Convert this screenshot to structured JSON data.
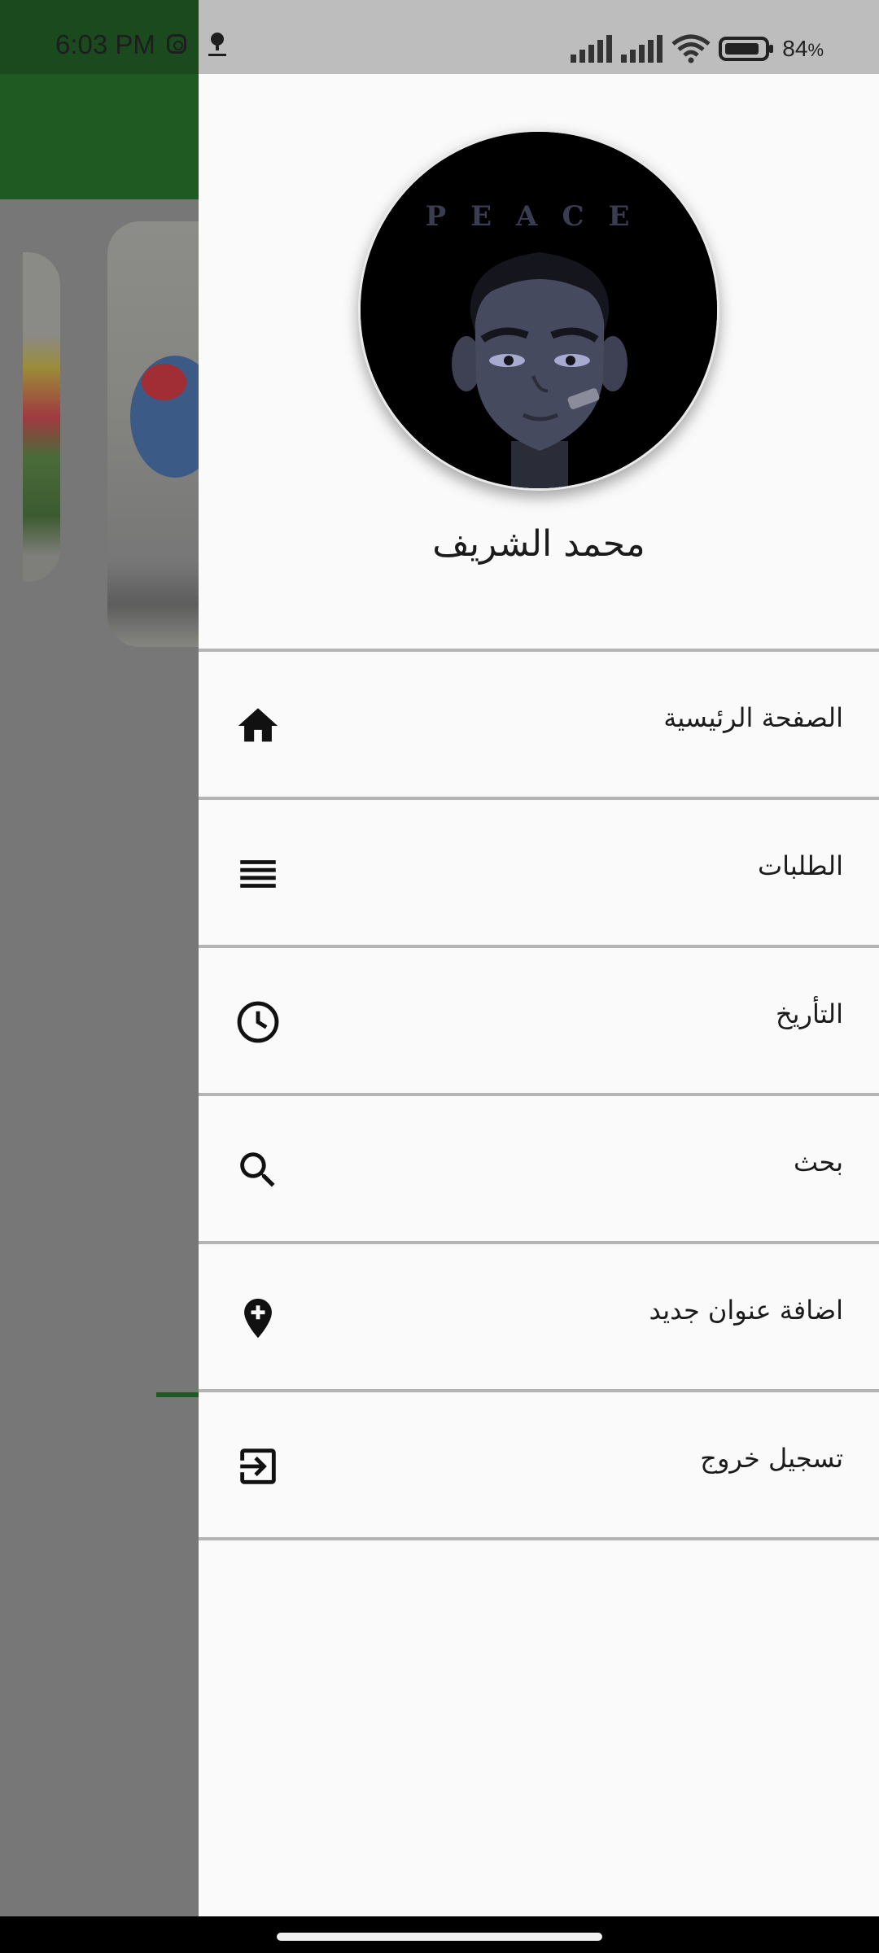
{
  "status_bar": {
    "time": "6:03 PM",
    "battery_percent": "84",
    "battery_suffix": "%",
    "icons": [
      "instagram-icon",
      "app-notification-icon",
      "signal-icon",
      "signal-icon",
      "wifi-icon",
      "battery-icon"
    ]
  },
  "drawer": {
    "profile": {
      "avatar_text": "PEACE",
      "name": "محمد الشريف"
    },
    "items": [
      {
        "label": "الصفحة الرئيسية",
        "icon": "home-icon"
      },
      {
        "label": "الطلبات",
        "icon": "list-icon"
      },
      {
        "label": "التأريخ",
        "icon": "clock-icon"
      },
      {
        "label": "بحث",
        "icon": "search-icon"
      },
      {
        "label": "اضافة عنوان جديد",
        "icon": "add-location-icon"
      },
      {
        "label": "تسجيل خروج",
        "icon": "logout-icon"
      }
    ]
  },
  "colors": {
    "app_bar": "#1f5a23",
    "drawer_bg": "#fafafa",
    "separator": "#b4b4b4",
    "scrim": "#777777"
  }
}
